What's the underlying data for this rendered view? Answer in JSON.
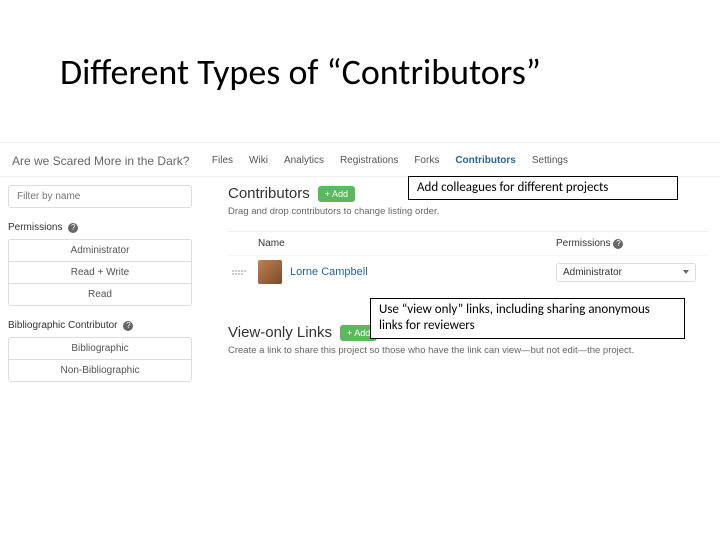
{
  "slide": {
    "title": "Different Types of “Contributors”",
    "callout1": "Add colleagues for different projects",
    "callout2": "Use “view only” links, including sharing anonymous links for reviewers"
  },
  "project": {
    "title": "Are we Scared More in the Dark?"
  },
  "nav": {
    "tabs": [
      "Files",
      "Wiki",
      "Analytics",
      "Registrations",
      "Forks",
      "Contributors",
      "Settings"
    ],
    "active": "Contributors"
  },
  "sidebar": {
    "filter_placeholder": "Filter by name",
    "permissions_label": "Permissions",
    "perm_options": [
      "Administrator",
      "Read + Write",
      "Read"
    ],
    "biblio_label": "Bibliographic Contributor",
    "biblio_options": [
      "Bibliographic",
      "Non-Bibliographic"
    ]
  },
  "contributors": {
    "heading": "Contributors",
    "add_label": "+ Add",
    "hint": "Drag and drop contributors to change listing order.",
    "col_name": "Name",
    "col_perm": "Permissions",
    "rows": [
      {
        "name": "Lorne Campbell",
        "permission": "Administrator"
      }
    ]
  },
  "view_only": {
    "heading": "View-only Links",
    "add_label": "+ Add",
    "hint": "Create a link to share this project so those who have the link can view—but not edit—the project."
  }
}
